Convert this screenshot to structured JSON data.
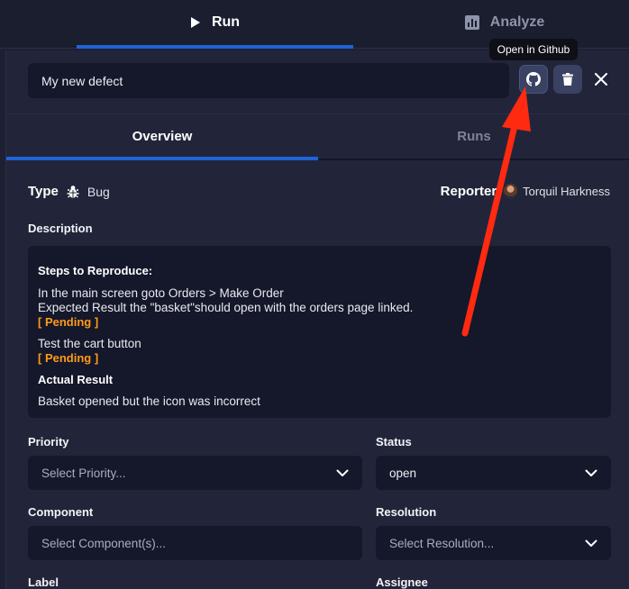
{
  "top_tabs": {
    "run": "Run",
    "analyze": "Analyze"
  },
  "header": {
    "title_value": "My new defect",
    "tooltip": "Open in Github"
  },
  "sub_tabs": {
    "overview": "Overview",
    "runs": "Runs"
  },
  "details": {
    "type_label": "Type",
    "type_value": "Bug",
    "reporter_label": "Reporter",
    "reporter_value": "Torquil Harkness"
  },
  "description": {
    "label": "Description",
    "steps_heading": "Steps to Reproduce:",
    "step1_line1": "In the main screen goto Orders > Make Order",
    "step1_line2": "Expected Result the \"basket\"should open with the orders page linked.",
    "pending1": "[ Pending ]",
    "step2": "Test the cart button",
    "pending2": "[ Pending ]",
    "actual_heading": "Actual Result",
    "actual_text": "Basket opened but the icon was incorrect"
  },
  "fields": {
    "priority_label": "Priority",
    "priority_placeholder": "Select Priority...",
    "status_label": "Status",
    "status_value": "open",
    "component_label": "Component",
    "component_placeholder": "Select Component(s)...",
    "resolution_label": "Resolution",
    "resolution_placeholder": "Select Resolution...",
    "label_label": "Label",
    "assignee_label": "Assignee"
  },
  "colors": {
    "accent": "#1e63d7",
    "pending": "#ff9b1a",
    "annotation_arrow": "#ff2a10"
  }
}
